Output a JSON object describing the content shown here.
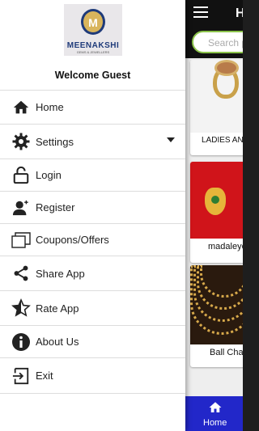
{
  "app": {
    "title_fragment": "H",
    "search_placeholder": "Search p",
    "products": [
      {
        "name": "LADIES ANG"
      },
      {
        "name": "madaleye"
      },
      {
        "name": "Ball Chain"
      }
    ],
    "bottom_nav": {
      "home_label": "Home",
      "color": "#2227c9"
    }
  },
  "drawer": {
    "logo": {
      "name": "MEENAKSHI",
      "sub": "GEMS & JEWELLERS",
      "initial": "M"
    },
    "welcome": "Welcome Guest",
    "items": [
      {
        "label": "Home",
        "icon": "home-icon"
      },
      {
        "label": "Settings",
        "icon": "gear-icon",
        "expandable": true
      },
      {
        "label": "Login",
        "icon": "unlock-icon"
      },
      {
        "label": "Register",
        "icon": "add-user-icon"
      },
      {
        "label": "Coupons/Offers",
        "icon": "coupons-icon"
      },
      {
        "label": "Share App",
        "icon": "share-icon"
      },
      {
        "label": "Rate App",
        "icon": "star-icon"
      },
      {
        "label": "About Us",
        "icon": "info-icon"
      },
      {
        "label": "Exit",
        "icon": "exit-icon"
      }
    ]
  }
}
